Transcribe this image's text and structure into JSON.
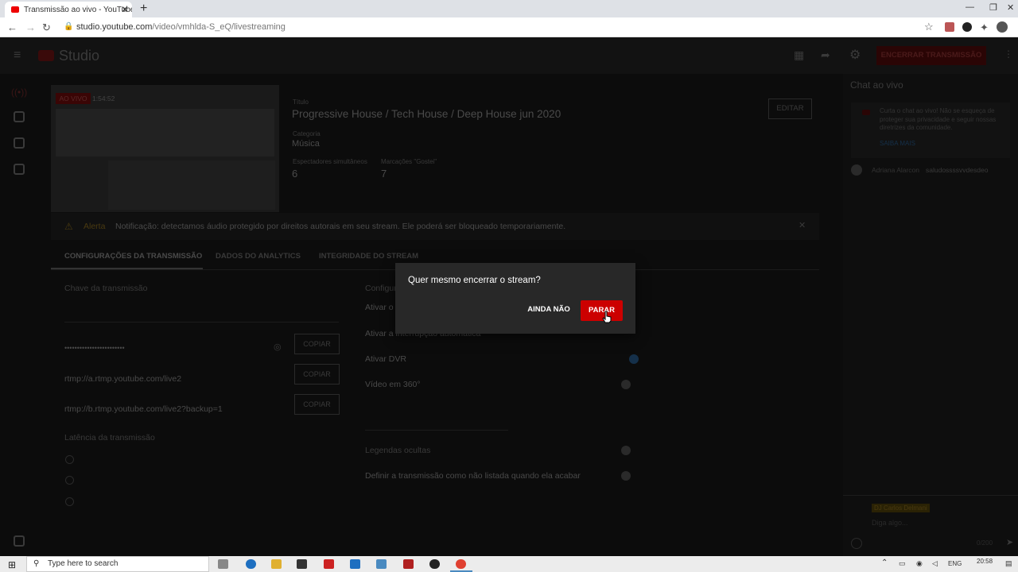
{
  "browser": {
    "tab_title": "Transmissão ao vivo - YouTube S",
    "url_host": "studio.youtube.com",
    "url_path": "/video/vmhlda-S_eQ/livestreaming"
  },
  "studio": {
    "logo": "Studio",
    "end_button": "ENCERRAR TRANSMISSÃO"
  },
  "stream": {
    "live_badge": "AO VIVO",
    "elapsed": "1:54:52",
    "title_label": "Título",
    "title": "Progressive House / Tech House / Deep House jun 2020",
    "category_label": "Categoria",
    "category": "Música",
    "viewers_label": "Espectadores simultâneos",
    "viewers": "6",
    "likes_label": "Marcações \"Gostei\"",
    "likes": "7",
    "edit_button": "EDITAR"
  },
  "alert": {
    "label": "Alerta",
    "text": "Notificação: detectamos áudio protegido por direitos autorais em seu stream. Ele poderá ser bloqueado temporariamente."
  },
  "tabs": [
    "CONFIGURAÇÕES DA TRANSMISSÃO",
    "DADOS DO ANALYTICS",
    "INTEGRIDADE DO STREAM"
  ],
  "settings": {
    "key_heading": "Chave da transmissão",
    "key_mask": "••••••••••••••••••••••••",
    "copy_label": "COPIAR",
    "rtmp_primary": "rtmp://a.rtmp.youtube.com/live2",
    "rtmp_backup": "rtmp://b.rtmp.youtube.com/live2?backup=1",
    "latency_heading": "Latência da transmissão",
    "config_heading": "Configurações",
    "auto_start": "Ativar o",
    "auto_stop": "Ativar a interrupção automática",
    "dvr": "Ativar DVR",
    "video360": "Vídeo em 360°",
    "captions": "Legendas ocultas",
    "unlisted": "Definir a transmissão como não listada quando ela acabar"
  },
  "chat": {
    "title": "Chat ao vivo",
    "welcome": "Curta o chat ao vivo! Não se esqueça de proteger sua privacidade e seguir nossas diretrizes da comunidade.",
    "learn_more": "SAIBA MAIS",
    "msg_author": "Adriana Alarcon",
    "msg_text": "saludossssvvdesdeo",
    "input_user": "DJ Carlos Delmani",
    "input_placeholder": "Diga algo...",
    "counter": "0/200"
  },
  "dialog": {
    "question": "Quer mesmo encerrar o stream?",
    "cancel": "AINDA NÃO",
    "confirm": "PARAR"
  },
  "taskbar": {
    "search_placeholder": "Type here to search",
    "lang": "ENG",
    "time": "20:58"
  },
  "colors": {
    "accent_red": "#cc0000",
    "dialog_bg": "#282828"
  }
}
